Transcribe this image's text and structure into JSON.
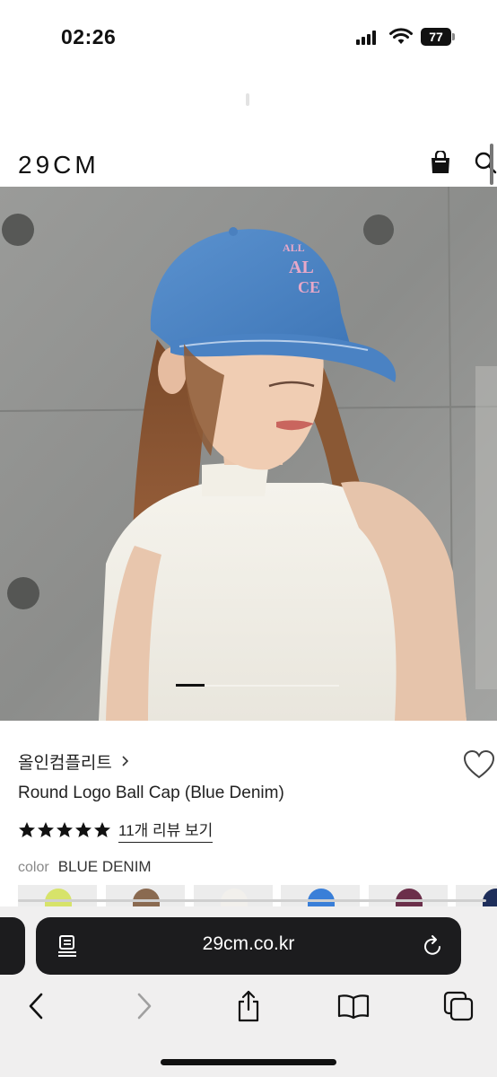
{
  "status_bar": {
    "time": "02:26",
    "battery_level": "77",
    "battery_percent": 77
  },
  "header": {
    "logo": "29CM",
    "icons": [
      "shopping-bag-icon",
      "search-icon"
    ]
  },
  "hero": {
    "image_alt": "Model wearing a blue denim round logo ball cap and white halter top",
    "carousel_active_index": 0
  },
  "product": {
    "brand": "올인컴플리트",
    "title": "Round Logo Ball Cap (Blue Denim)",
    "rating_stars": 5,
    "review_link": "11개 리뷰 보기",
    "color_label": "color",
    "color_value": "BLUE DENIM",
    "swatch_colors": [
      "#d7e36a",
      "#8a6a50",
      "#f2f0ec",
      "#3a7fd8",
      "#6b2f4a",
      "#1e2e5a"
    ]
  },
  "browser": {
    "url": "29cm.co.kr",
    "toolbar": [
      "back-icon",
      "forward-icon",
      "share-icon",
      "bookmarks-icon",
      "tabs-icon"
    ]
  },
  "colors": {
    "accent": "#111111",
    "star": "#111111",
    "safari_address_bg": "#1c1c1e",
    "safari_toolbar_bg": "#f0efef"
  }
}
